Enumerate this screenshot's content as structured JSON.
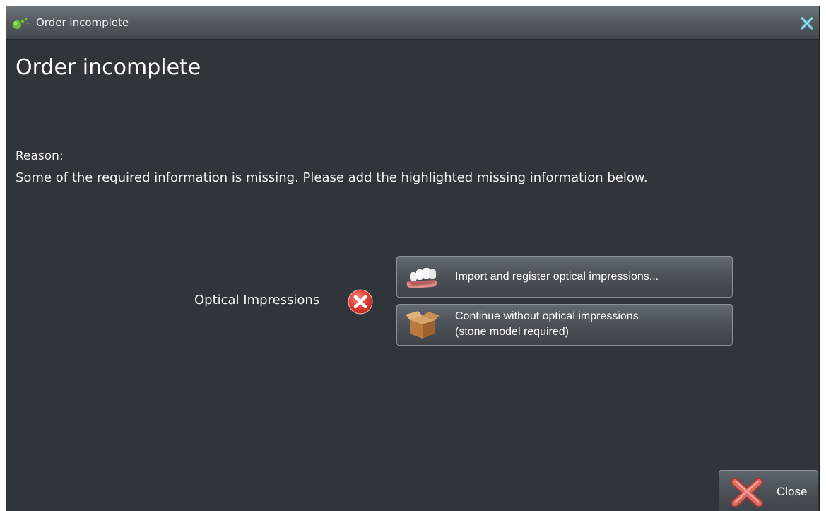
{
  "window": {
    "title": "Order incomplete"
  },
  "main": {
    "heading": "Order incomplete",
    "reason_label": "Reason:",
    "reason_text": "Some of the required information is missing. Please add the highlighted missing information below."
  },
  "item": {
    "label": "Optical Impressions",
    "status": "missing"
  },
  "actions": {
    "import_label": "Import and register optical impressions...",
    "continue_line1": "Continue without optical impressions",
    "continue_line2": "(stone model required)"
  },
  "footer": {
    "close_label": "Close"
  },
  "colors": {
    "background": "#2f353b",
    "error": "#e0433a",
    "titlebar": "#565c62"
  }
}
